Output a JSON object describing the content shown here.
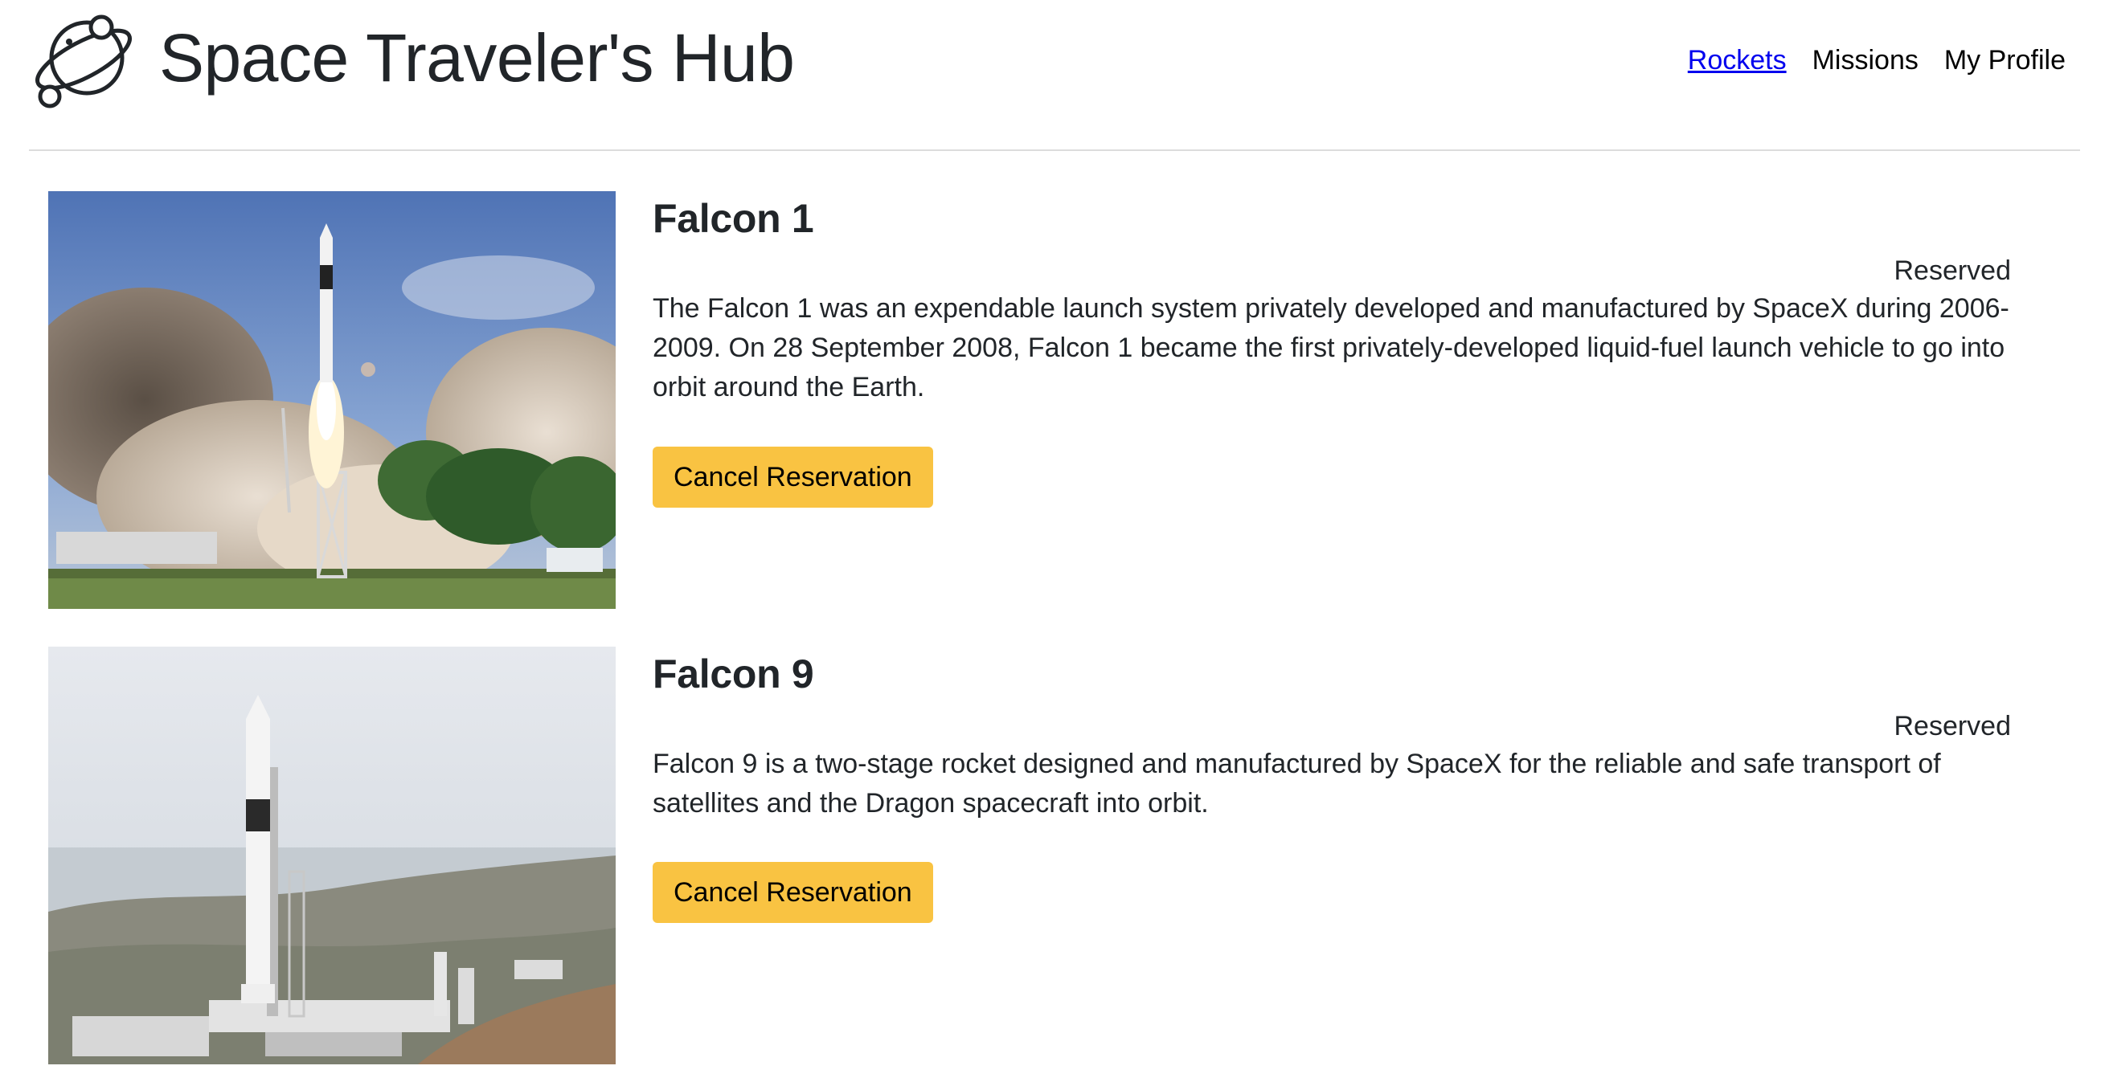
{
  "header": {
    "title": "Space Traveler's Hub",
    "logo_icon": "planet-icon",
    "nav": [
      {
        "label": "Rockets",
        "active": true
      },
      {
        "label": "Missions",
        "active": false
      },
      {
        "label": "My Profile",
        "active": false
      }
    ]
  },
  "rockets": [
    {
      "name": "Falcon 1",
      "status": "Reserved",
      "description": "The Falcon 1 was an expendable launch system privately developed and manufactured by SpaceX during 2006-2009. On 28 September 2008, Falcon 1 became the first privately-developed liquid-fuel launch vehicle to go into orbit around the Earth.",
      "button_label": "Cancel Reservation",
      "image_icon": "rocket-launch-photo"
    },
    {
      "name": "Falcon 9",
      "status": "Reserved",
      "description": "Falcon 9 is a two-stage rocket designed and manufactured by SpaceX for the reliable and safe transport of satellites and the Dragon spacecraft into orbit.",
      "button_label": "Cancel Reservation",
      "image_icon": "rocket-on-pad-photo"
    }
  ],
  "colors": {
    "button": "#f9c342",
    "link_active": "#0000ee",
    "text": "#212529"
  }
}
